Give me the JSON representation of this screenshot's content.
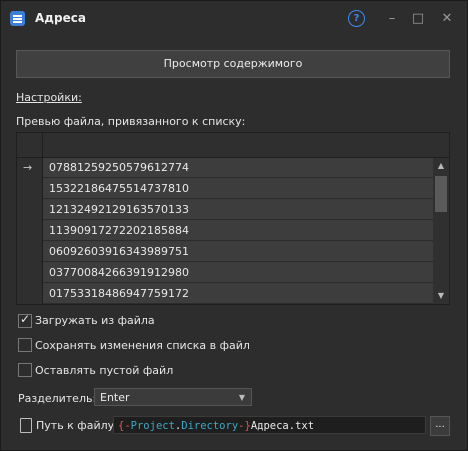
{
  "window": {
    "title": "Адреса",
    "help": "?",
    "minimize": "–",
    "maximize": "□",
    "close": "✕"
  },
  "view_button": "Просмотр содержимого",
  "settings_link": "Настройки:",
  "preview_label": "Превью файла, привязанного к списку:",
  "grid": {
    "current_row_marker": "→",
    "rows": [
      "07881259250579612774",
      "15322186475514737810",
      "12132492129163570133",
      "11390917272202185884",
      "06092603916343989751",
      "03770084266391912980",
      "01753318486947759172"
    ],
    "scroll_up": "▲",
    "scroll_down": "▼"
  },
  "options": {
    "load_from_file": {
      "label": "Загружать из файла",
      "checked": true
    },
    "save_changes": {
      "label": "Сохранять изменения списка в файл",
      "checked": false
    },
    "leave_empty": {
      "label": "Оставлять пустой файл",
      "checked": false
    }
  },
  "separator": {
    "label": "Разделитель:",
    "value": "Enter",
    "caret": "▼"
  },
  "path": {
    "label": "Путь к файлу",
    "open_brace": "{-",
    "project": "Project",
    "dot": ".",
    "directory": "Directory",
    "close_brace": "-}",
    "file": "Адреса.txt",
    "browse": "..."
  },
  "colors": {
    "accent": "#3d8ae8",
    "brace": "#e05a4f",
    "variable": "#3ea8c6"
  }
}
